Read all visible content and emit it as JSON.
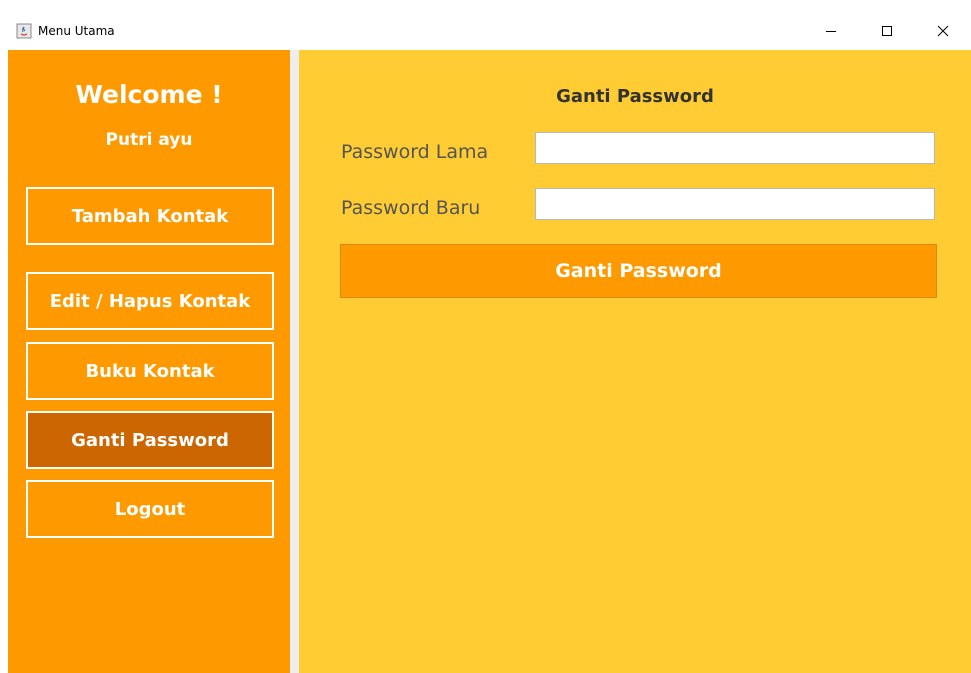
{
  "window": {
    "title": "Menu Utama",
    "controls": {
      "minimize_icon": "minimize-icon",
      "maximize_icon": "maximize-icon",
      "close_icon": "close-icon"
    }
  },
  "sidebar": {
    "welcome": "Welcome !",
    "username": "Putri ayu",
    "items": [
      {
        "label": "Tambah Kontak",
        "active": false
      },
      {
        "label": "Edit / Hapus Kontak",
        "active": false
      },
      {
        "label": "Buku Kontak",
        "active": false
      },
      {
        "label": "Ganti Password",
        "active": true
      },
      {
        "label": "Logout",
        "active": false
      }
    ]
  },
  "main": {
    "title": "Ganti Password",
    "fields": [
      {
        "label": "Password Lama",
        "value": ""
      },
      {
        "label": "Password Baru",
        "value": ""
      }
    ],
    "submit_label": "Ganti Password"
  },
  "colors": {
    "sidebar_bg": "#ff9900",
    "main_bg": "#ffcc33",
    "active_item": "#cc6600",
    "button_bg": "#ff9900"
  }
}
